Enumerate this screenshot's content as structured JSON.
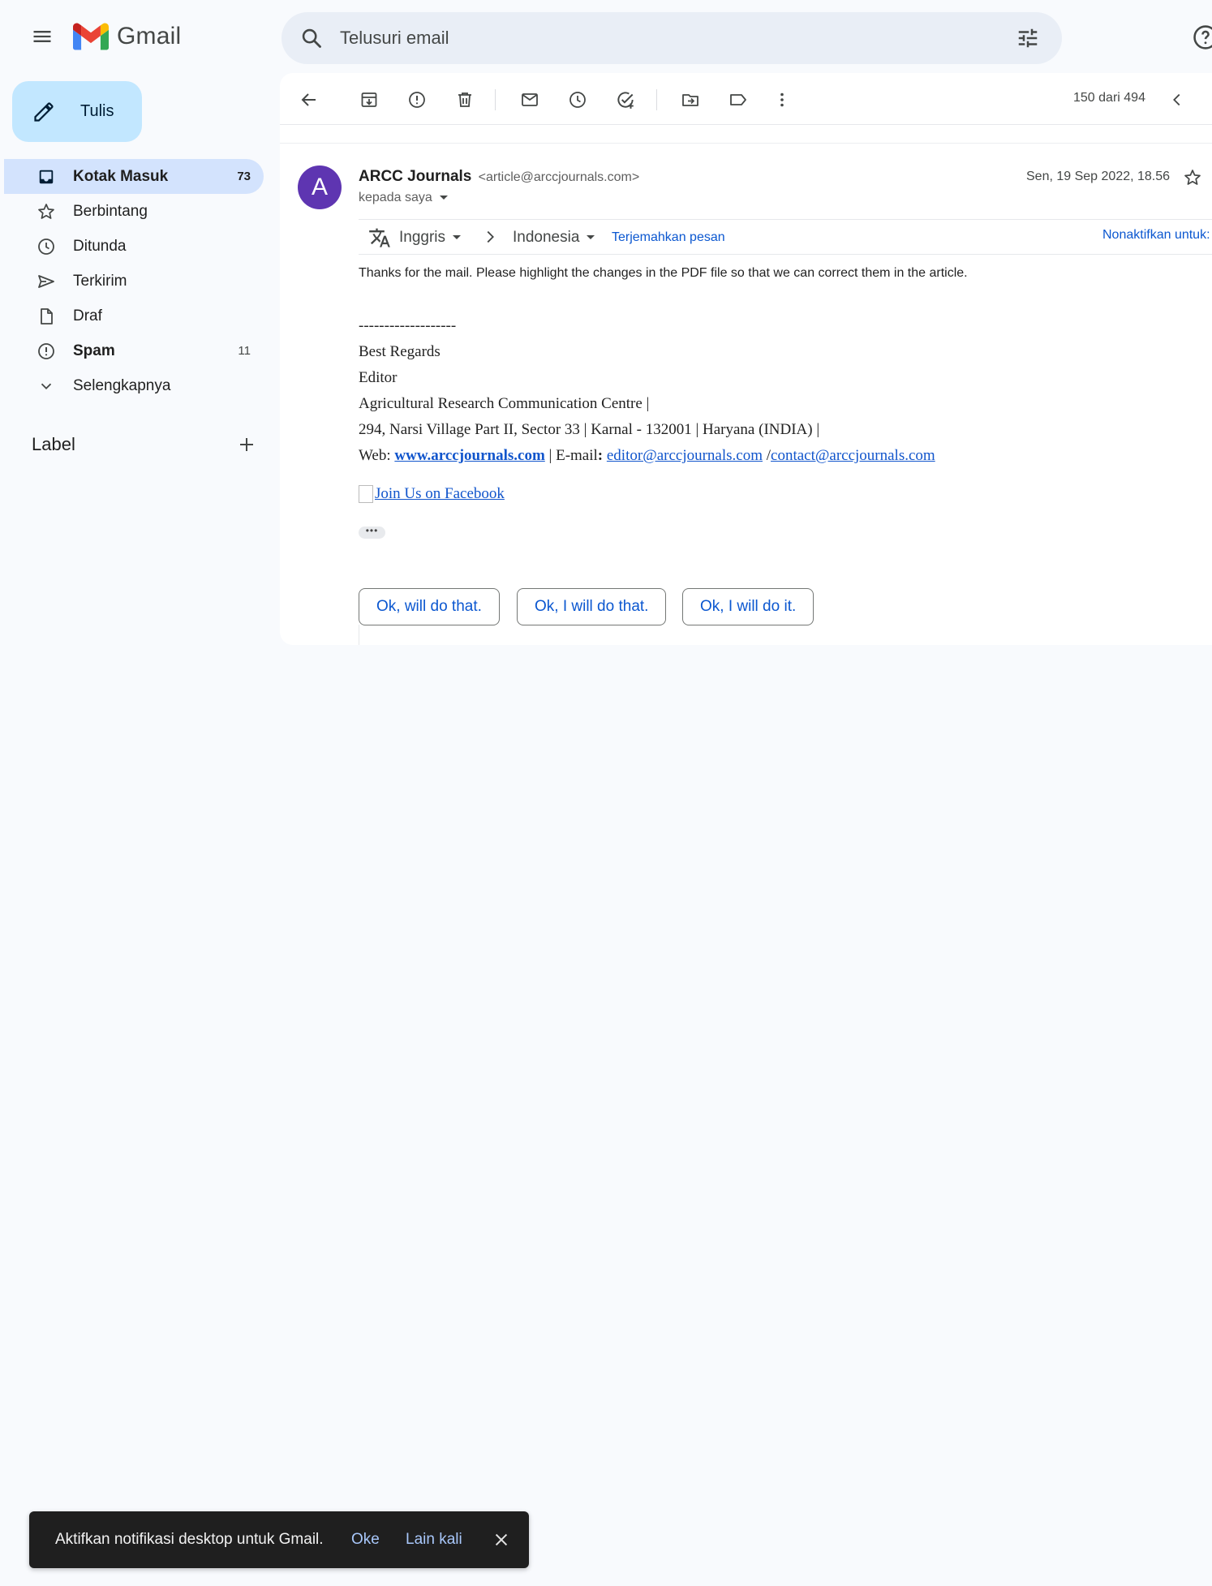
{
  "header": {
    "app_name": "Gmail",
    "search_placeholder": "Telusuri email"
  },
  "sidebar": {
    "compose_label": "Tulis",
    "items": [
      {
        "label": "Kotak Masuk",
        "count": "73",
        "icon": "inbox-icon",
        "active": true
      },
      {
        "label": "Berbintang",
        "count": "",
        "icon": "star-icon"
      },
      {
        "label": "Ditunda",
        "count": "",
        "icon": "clock-icon"
      },
      {
        "label": "Terkirim",
        "count": "",
        "icon": "send-icon"
      },
      {
        "label": "Draf",
        "count": "",
        "icon": "file-icon"
      },
      {
        "label": "Spam",
        "count": "11",
        "icon": "spam-icon",
        "bold": true
      },
      {
        "label": "Selengkapnya",
        "count": "",
        "icon": "chevron-down-icon"
      }
    ],
    "labels_title": "Label"
  },
  "toolbar": {
    "pager": "150 dari 494",
    "icons": [
      "back-arrow-icon",
      "archive-icon",
      "report-spam-icon",
      "delete-icon",
      "mark-unread-icon",
      "snooze-icon",
      "add-task-icon",
      "move-to-icon",
      "label-icon",
      "more-vert-icon",
      "prev-chevron-icon"
    ]
  },
  "message": {
    "avatar_letter": "A",
    "avatar_color": "#5e35b1",
    "sender_name": "ARCC Journals",
    "sender_email": "<article@arccjournals.com>",
    "to": "kepada saya",
    "date": "Sen, 19 Sep 2022, 18.56",
    "translate": {
      "from": "Inggris",
      "to": "Indonesia",
      "translate_link": "Terjemahkan pesan",
      "disable_link": "Nonaktifkan untuk: Inggris"
    },
    "body": "Thanks for the mail. Please highlight the changes in the PDF file so that we can correct them in the article.",
    "signature": {
      "separator": "-------------------",
      "line1": "Best Regards",
      "line2": "Editor",
      "line3": "Agricultural Research Communication Centre |",
      "line4": "294, Narsi Village Part II, Sector 33 | Karnal - 132001 | Haryana (INDIA) |",
      "web_label": "Web: ",
      "web_link": "www.arccjournals.com",
      "email_label_pre": " | E-mail",
      "email_colon": ":",
      "email1": "editor@arccjournals.com",
      "email_sep": " /",
      "email2": "contact@arccjournals.com"
    },
    "facebook_link": "Join Us on Facebook",
    "ellipsis": "•••",
    "smart_replies": [
      "Ok, will do that.",
      "Ok, I will do that.",
      "Ok, I will do it."
    ]
  },
  "snackbar": {
    "message": "Aktifkan notifikasi desktop untuk Gmail.",
    "ok": "Oke",
    "later": "Lain kali"
  },
  "colors": {
    "accent": "#0b57d0",
    "compose_bg": "#c2e7ff",
    "active_nav_bg": "#d3e3fd",
    "search_bg": "#e9eef6",
    "page_bg": "#f8fafd"
  }
}
